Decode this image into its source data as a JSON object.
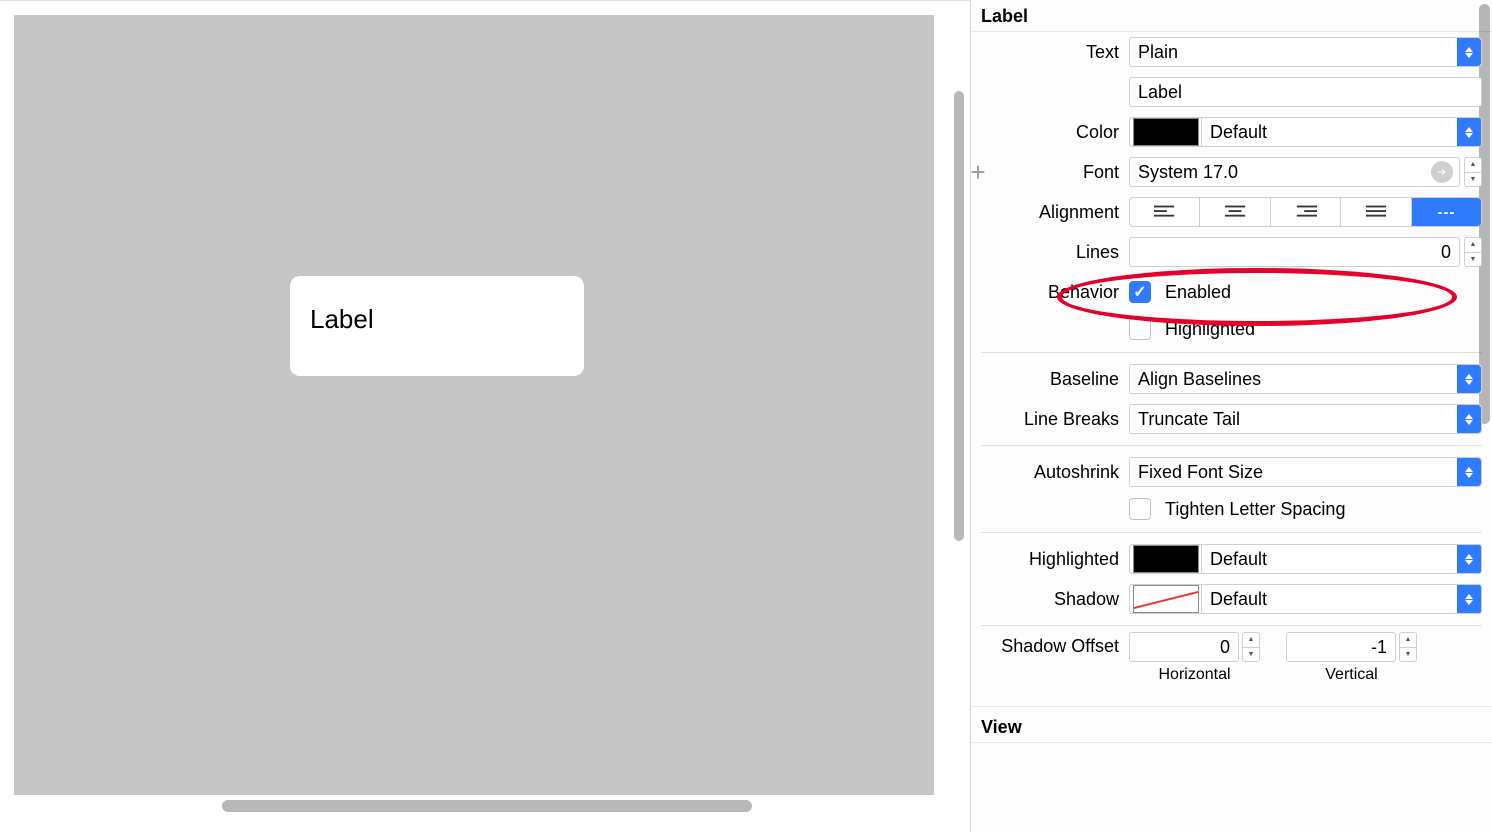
{
  "section_labels": {
    "label": "Label",
    "view": "View"
  },
  "canvas": {
    "label_text": "Label"
  },
  "props": {
    "text_label": "Text",
    "text_style": "Plain",
    "text_value": "Label",
    "color_label": "Color",
    "color_name": "Default",
    "font_label": "Font",
    "font_value": "System 17.0",
    "alignment_label": "Alignment",
    "lines_label": "Lines",
    "lines_value": "0",
    "behavior_label": "Behavior",
    "behavior_enabled": "Enabled",
    "behavior_highlighted": "Highlighted",
    "baseline_label": "Baseline",
    "baseline_value": "Align Baselines",
    "linebreaks_label": "Line Breaks",
    "linebreaks_value": "Truncate Tail",
    "autoshrink_label": "Autoshrink",
    "autoshrink_value": "Fixed Font Size",
    "tighten_label": "Tighten Letter Spacing",
    "highlighted_label": "Highlighted",
    "highlighted_value": "Default",
    "shadow_label": "Shadow",
    "shadow_value": "Default",
    "shadow_offset_label": "Shadow Offset",
    "shadow_offset_h": "0",
    "shadow_offset_h_label": "Horizontal",
    "shadow_offset_v": "-1",
    "shadow_offset_v_label": "Vertical"
  },
  "alignment": {
    "natural_glyph": "---"
  }
}
